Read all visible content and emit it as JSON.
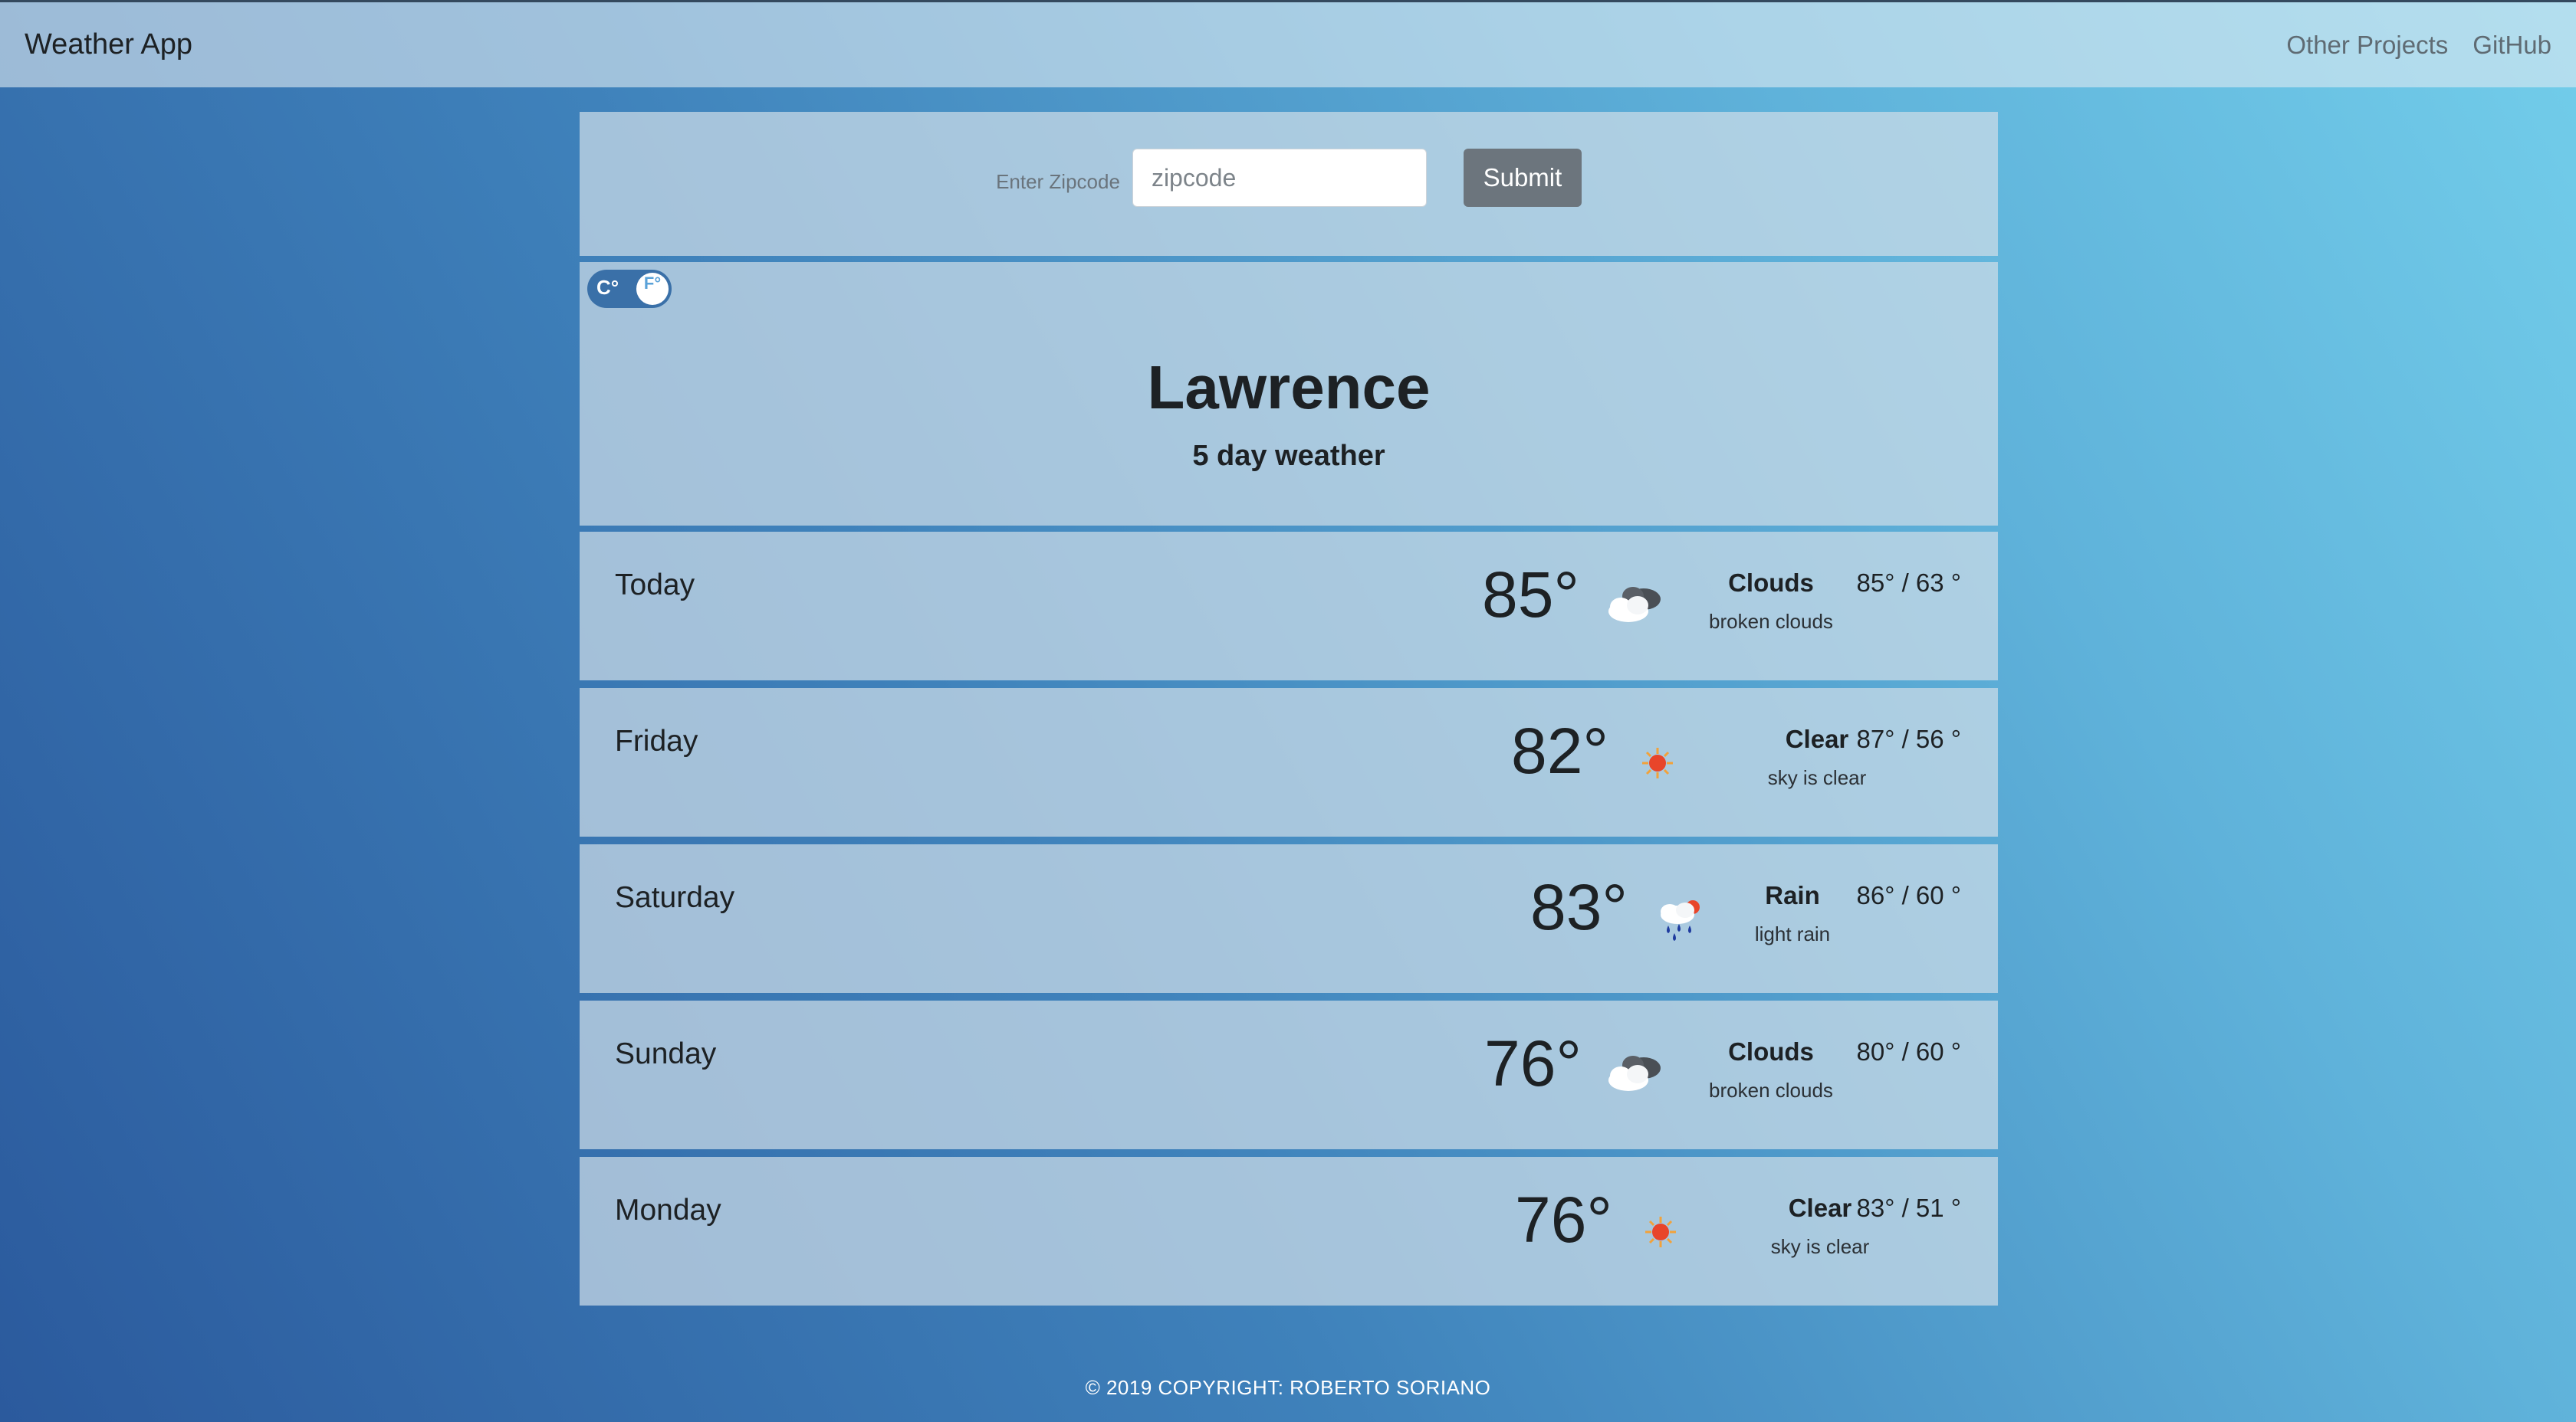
{
  "navbar": {
    "brand": "Weather App",
    "links": [
      "Other Projects",
      "GitHub"
    ]
  },
  "search": {
    "label": "Enter Zipcode",
    "placeholder": "zipcode",
    "value": "",
    "submit_label": "Submit"
  },
  "units_toggle": {
    "left": "C°",
    "right": "F°",
    "selected": "F°"
  },
  "forecast_header": {
    "city": "Lawrence",
    "subtitle": "5 day weather"
  },
  "days": [
    {
      "name": "Today",
      "temp": "85°",
      "icon": "broken-clouds-icon",
      "main": "Clouds",
      "desc": "broken clouds",
      "hilo": "85° / 63 °"
    },
    {
      "name": "Friday",
      "temp": "82°",
      "icon": "clear-sun-icon",
      "main": "Clear",
      "desc": "sky is clear",
      "hilo": "87° / 56 °"
    },
    {
      "name": "Saturday",
      "temp": "83°",
      "icon": "light-rain-icon",
      "main": "Rain",
      "desc": "light rain",
      "hilo": "86° / 60 °"
    },
    {
      "name": "Sunday",
      "temp": "76°",
      "icon": "broken-clouds-icon",
      "main": "Clouds",
      "desc": "broken clouds",
      "hilo": "80° / 60 °"
    },
    {
      "name": "Monday",
      "temp": "76°",
      "icon": "clear-sun-icon",
      "main": "Clear",
      "desc": "sky is clear",
      "hilo": "83° / 51 °"
    }
  ],
  "footer": {
    "text": "© 2019 COPYRIGHT: ROBERTO SORIANO"
  },
  "colors": {
    "submit_bg": "#6c757d",
    "toggle_bg": "#3a70a8",
    "sun": "#e8452a"
  }
}
